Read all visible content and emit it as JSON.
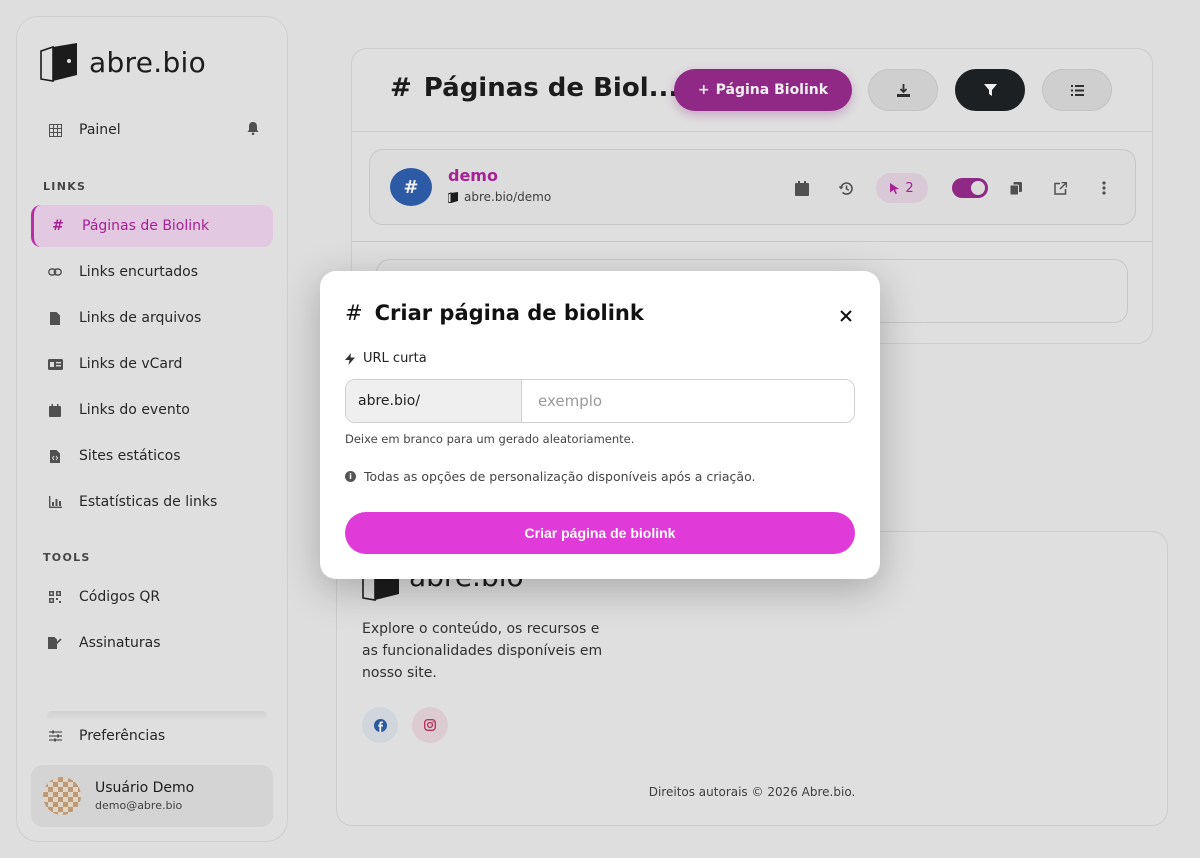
{
  "brand": {
    "name": "abre.bio"
  },
  "sidebar": {
    "top_item": {
      "label": "Painel",
      "icon": "grid-icon"
    },
    "sections": [
      {
        "label": "LINKS"
      },
      {
        "label": "TOOLS"
      }
    ],
    "links": [
      {
        "label": "Páginas de Biolink",
        "icon": "hash-icon",
        "active": true
      },
      {
        "label": "Links encurtados",
        "icon": "link-icon"
      },
      {
        "label": "Links de arquivos",
        "icon": "file-icon"
      },
      {
        "label": "Links de vCard",
        "icon": "id-card-icon"
      },
      {
        "label": "Links do evento",
        "icon": "calendar-icon"
      },
      {
        "label": "Sites estáticos",
        "icon": "file-code-icon"
      },
      {
        "label": "Estatísticas de links",
        "icon": "chart-icon"
      }
    ],
    "tools": [
      {
        "label": "Códigos QR",
        "icon": "qr-icon"
      },
      {
        "label": "Assinaturas",
        "icon": "signature-icon"
      }
    ],
    "preferences": {
      "label": "Preferências",
      "icon": "sliders-icon"
    },
    "user": {
      "name": "Usuário Demo",
      "email": "demo@abre.bio"
    }
  },
  "main": {
    "title": "Páginas de Biol...",
    "title_icon": "#",
    "add_button": "Página Biolink",
    "link": {
      "name": "demo",
      "url": "abre.bio/demo",
      "clicks": "2",
      "enabled": true
    }
  },
  "footer": {
    "brand": "abre.bio",
    "description": "Explore o conteúdo, os recursos e as funcionalidades disponíveis em nosso site.",
    "copyright": "Direitos autorais © 2026 Abre.bio."
  },
  "modal": {
    "title": "Criar página de biolink",
    "title_icon": "#",
    "field_label": "URL curta",
    "prefix": "abre.bio/",
    "placeholder": "exemplo",
    "help": "Deixe em branco para um gerado aleatoriamente.",
    "info": "Todas as opções de personalização disponíveis após a criação.",
    "submit": "Criar página de biolink"
  },
  "colors": {
    "accent": "#e03ad9",
    "accent_dark": "#9a2b8e",
    "active_text": "#b0249e"
  }
}
